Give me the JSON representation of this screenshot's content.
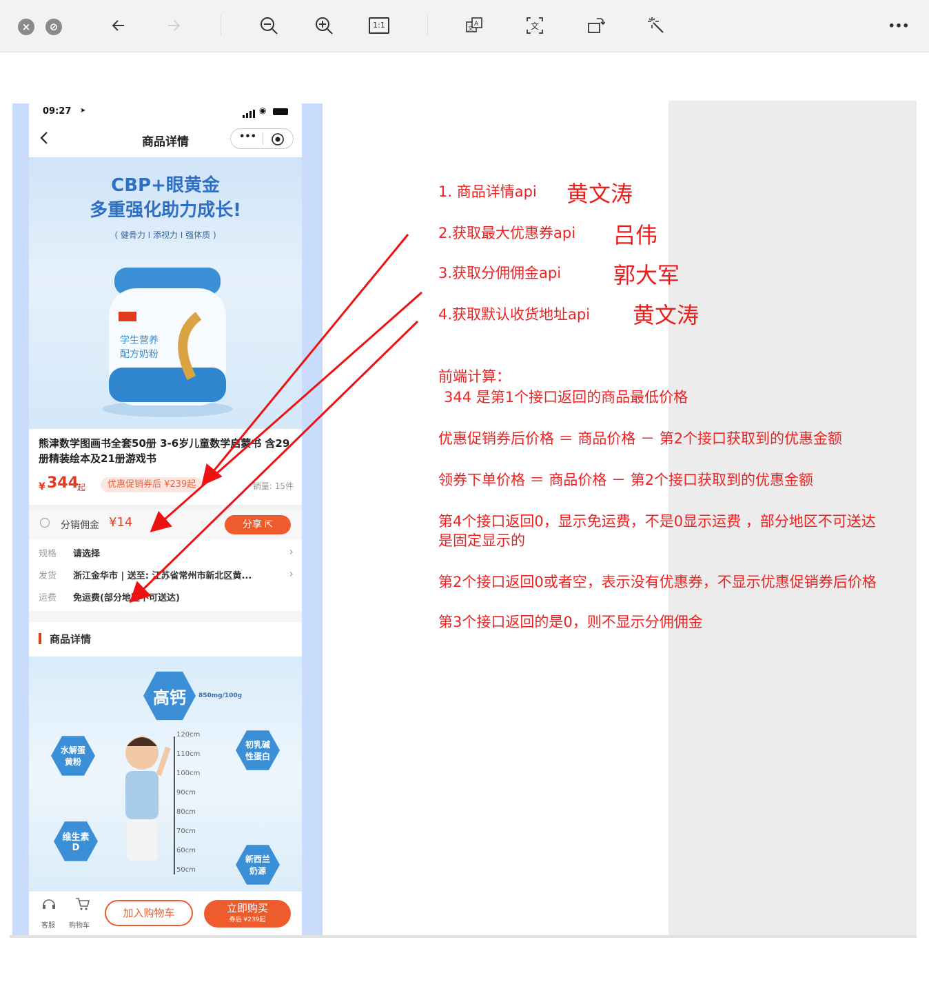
{
  "toolbar": {
    "close_icon": "x-circle-icon",
    "minimize_icon": "minus-circle-icon",
    "back_icon": "arrow-left-icon",
    "forward_icon": "arrow-right-icon",
    "zoom_out_icon": "zoom-out-icon",
    "zoom_in_icon": "zoom-in-icon",
    "actual_size_label": "1:1",
    "translate_icon": "translate-icon",
    "text_recognize_label": "文",
    "rotate_icon": "rotate-icon",
    "enhance_icon": "magic-wand-icon",
    "more_label": "•••"
  },
  "phone": {
    "status_time": "09:27",
    "nav_title": "商品详情",
    "capsule_more": "•••",
    "banner": {
      "line1": "CBP+眼黄金",
      "line2": "多重强化助力成长!",
      "line3": "( 健骨力 I 添视力 I 强体质 )"
    },
    "product_title": "熊津数学图画书全套50册 3-6岁儿童数学启蒙书 含29册精装绘本及21册游戏书",
    "price_yen": "¥",
    "price": "344",
    "price_suffix": "起",
    "coupon_tag": "优惠促销券后 ¥239起",
    "sales": "销量: 15件",
    "commission_label": "分销佣金",
    "commission_value": "¥14",
    "share_label": "分享 ⇱",
    "spec": {
      "key": "规格",
      "value": "请选择"
    },
    "ship": {
      "key": "发货",
      "value": "浙江金华市 | 送至: 江苏省常州市新北区黄..."
    },
    "freight": {
      "key": "运费",
      "value": "免运费(部分地区不可送达)"
    },
    "detail_title": "商品详情",
    "detail_image": {
      "hex_calcium": "高钙",
      "calcium_note": "850mg/100g",
      "hex_hydro": "水解蛋黄粉",
      "hex_whey": "初乳碱性蛋白",
      "hex_vitd": "维生素D",
      "hex_nz": "新西兰奶源",
      "heights": [
        "120cm",
        "110cm",
        "100cm",
        "90cm",
        "80cm",
        "70cm",
        "60cm",
        "50cm"
      ]
    },
    "bottom": {
      "service_label": "客服",
      "cart_icon_label": "购物车",
      "add_cart": "加入购物车",
      "buy_now": "立即购买",
      "buy_sub": "券后 ¥239起"
    }
  },
  "annotations": {
    "items": [
      {
        "text": "1. 商品详情api",
        "owner": "黄文涛"
      },
      {
        "text": "2.获取最大优惠券api",
        "owner": "吕伟"
      },
      {
        "text": "3.获取分佣佣金api",
        "owner": "郭大军"
      },
      {
        "text": "4.获取默认收货地址api",
        "owner": "黄文涛"
      }
    ],
    "calc_title": "前端计算：",
    "calc_1": "344 是第1个接口返回的商品最低价格",
    "calc_2": "优惠促销券后价格 ＝ 商品价格 － 第2个接口获取到的优惠金额",
    "calc_3": "领券下单价格 ＝ 商品价格 － 第2个接口获取到的优惠金额",
    "calc_4a": "第4个接口返回0，显示免运费，不是0显示运费 ，部分地区不可送达",
    "calc_4b": "是固定显示的",
    "calc_5": "第2个接口返回0或者空，表示没有优惠券，不显示优惠促销券后价格",
    "calc_6": "第3个接口返回的是0，则不显示分佣佣金",
    "arrow_color": "#ee1111"
  }
}
